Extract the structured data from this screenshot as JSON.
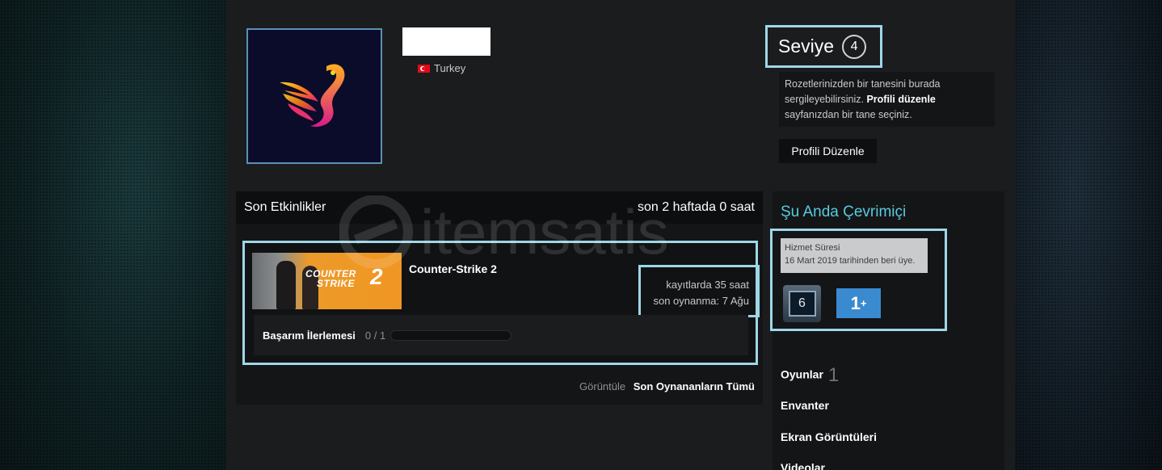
{
  "profile": {
    "country": "Turkey",
    "level_label": "Seviye",
    "level": "4",
    "badge_note_prefix": "Rozetlerinizden bir tanesini burada sergileyebilirsiniz.",
    "badge_note_link": "Profili düzenle",
    "badge_note_suffix": "sayfanızdan bir tane seçiniz.",
    "edit_button": "Profili Düzenle"
  },
  "activity": {
    "title": "Son Etkinlikler",
    "summary": "son 2 haftada 0 saat",
    "game": {
      "name": "Counter-Strike 2",
      "capsule_line1": "COUNTER",
      "capsule_line2": "STRIKE",
      "capsule_num": "2",
      "hours": "kayıtlarda 35 saat",
      "last_played": "son oynanma: 7 Ağu",
      "achievement_label": "Başarım İlerlemesi",
      "achievement_count": "0 / 1",
      "achievement_progress": 0
    },
    "footer_view": "Görüntüle",
    "footer_link": "Son Oynananların Tümü"
  },
  "side": {
    "online_title": "Şu Anda Çevrimiçi",
    "service_title": "Hizmet Süresi",
    "service_since": "16 Mart 2019 tarihinden beri üye.",
    "badge_years": "6",
    "badge_games": "1",
    "badge_games_sup": "+",
    "links": {
      "games": "Oyunlar",
      "games_count": "1",
      "inventory": "Envanter",
      "screenshots": "Ekran Görüntüleri",
      "videos": "Videolar"
    }
  },
  "watermark": "itemsatis",
  "colors": {
    "accent": "#57cbde",
    "highlight": "#9fd6e8",
    "panel": "#141517",
    "background": "#1b1c1e"
  }
}
